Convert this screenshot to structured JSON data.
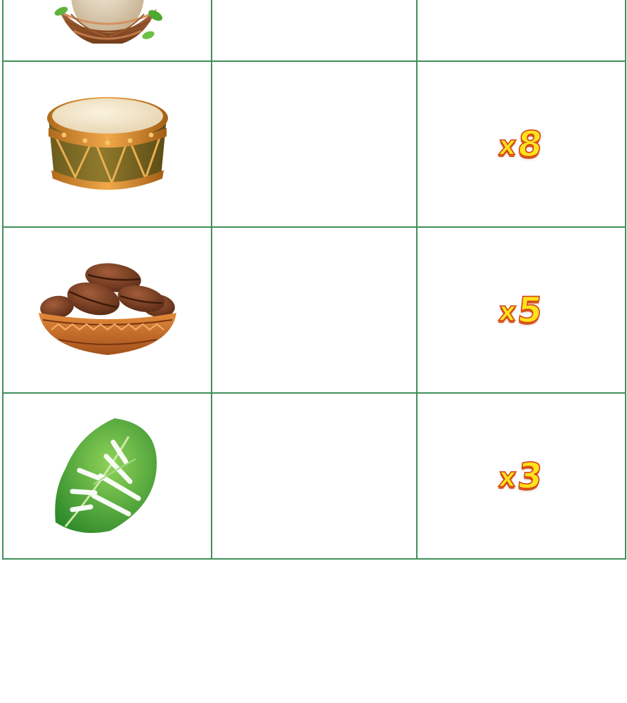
{
  "paytable": {
    "rows": [
      {
        "symbol": "nest-with-egg-icon",
        "multiplier_prefix": "",
        "multiplier_value": ""
      },
      {
        "symbol": "drum-icon",
        "multiplier_prefix": "x",
        "multiplier_value": "8"
      },
      {
        "symbol": "coffee-beans-bowl-icon",
        "multiplier_prefix": "x",
        "multiplier_value": "5"
      },
      {
        "symbol": "monstera-leaf-icon",
        "multiplier_prefix": "x",
        "multiplier_value": "3"
      }
    ]
  },
  "colors": {
    "grid_line": "#3f8f5a",
    "multiplier_fill": "#ffe21a",
    "multiplier_outline": "#d2461a"
  }
}
